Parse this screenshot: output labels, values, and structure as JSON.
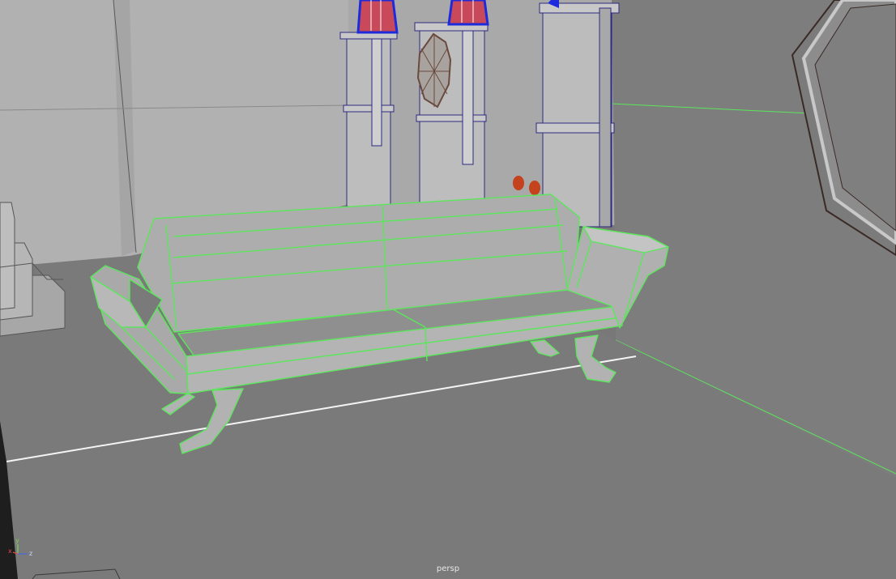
{
  "viewport": {
    "camera_label": "persp",
    "selection_color": "#5ce65c",
    "background_color": "#787878"
  },
  "axis_gizmo": {
    "x_label": "x",
    "y_label": "y",
    "z_label": "z",
    "x_color": "#e04a4a",
    "y_color": "#7ad35a",
    "z_color": "#4a6ae0"
  }
}
